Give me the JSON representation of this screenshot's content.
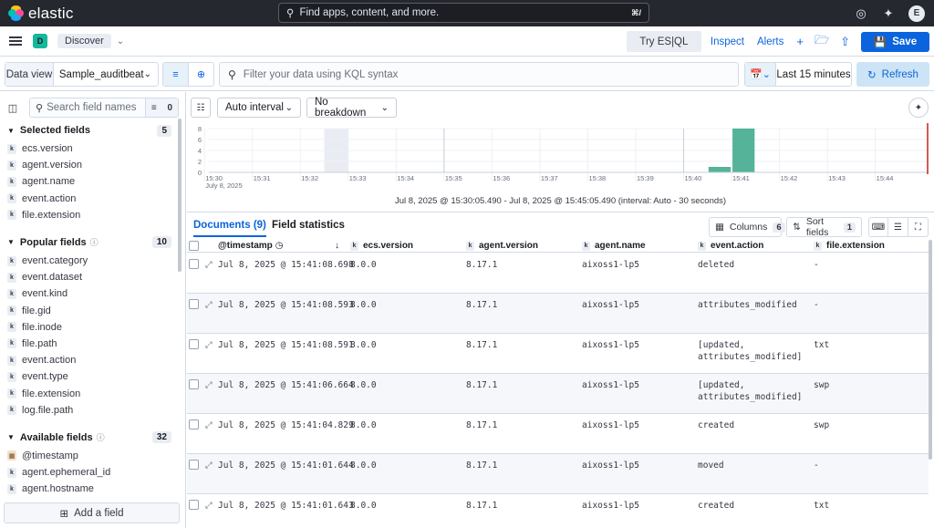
{
  "topbar": {
    "brand": "elastic",
    "search_placeholder": "Find apps, content, and more.",
    "search_shortcut": "⌘/",
    "avatar_initial": "E"
  },
  "appbar": {
    "space_initial": "D",
    "breadcrumb": "Discover",
    "try_esql": "Try ES|QL",
    "inspect": "Inspect",
    "alerts": "Alerts",
    "save": "Save"
  },
  "querybar": {
    "data_view_label": "Data view",
    "data_view_value": "Sample_auditbeat",
    "kql_placeholder": "Filter your data using KQL syntax",
    "time_range": "Last 15 minutes",
    "refresh": "Refresh"
  },
  "sidebar": {
    "search_placeholder": "Search field names",
    "filter_count": "0",
    "selected": {
      "title": "Selected fields",
      "count": "5",
      "fields": [
        "ecs.version",
        "agent.version",
        "agent.name",
        "event.action",
        "file.extension"
      ]
    },
    "popular": {
      "title": "Popular fields",
      "count": "10",
      "fields": [
        "event.category",
        "event.dataset",
        "event.kind",
        "file.gid",
        "file.inode",
        "file.path",
        "event.action",
        "event.type",
        "file.extension",
        "log.file.path"
      ]
    },
    "available": {
      "title": "Available fields",
      "count": "32",
      "fields": [
        {
          "name": "@timestamp",
          "type": "date"
        },
        {
          "name": "agent.ephemeral_id",
          "type": "k"
        },
        {
          "name": "agent.hostname",
          "type": "k"
        }
      ]
    },
    "add_field": "Add a field"
  },
  "toolbar": {
    "interval": "Auto interval",
    "breakdown": "No breakdown"
  },
  "chart_data": {
    "type": "bar",
    "y_ticks": [
      "8",
      "6",
      "4",
      "2",
      "0"
    ],
    "ylim": [
      0,
      8
    ],
    "x_ticks": [
      "15:30",
      "15:31",
      "15:32",
      "15:33",
      "15:34",
      "15:35",
      "15:36",
      "15:37",
      "15:38",
      "15:39",
      "15:40",
      "15:41",
      "15:42",
      "15:43",
      "15:44"
    ],
    "x_sublabel": "July 8, 2025",
    "bars": [
      {
        "x": "15:40:30",
        "value": 1
      },
      {
        "x": "15:41:00",
        "value": 8
      }
    ],
    "bar_color": "#54b399",
    "caption": "Jul 8, 2025 @ 15:30:05.490 - Jul 8, 2025 @ 15:45:05.490 (interval: Auto - 30 seconds)"
  },
  "tabs": {
    "documents": "Documents (9)",
    "field_statistics": "Field statistics",
    "columns": "Columns",
    "columns_count": "6",
    "sort_fields": "Sort fields",
    "sort_count": "1"
  },
  "grid": {
    "columns": [
      "@timestamp",
      "ecs.version",
      "agent.version",
      "agent.name",
      "event.action",
      "file.extension"
    ],
    "rows": [
      {
        "ts": "Jul 8, 2025 @ 15:41:08.698",
        "ecs": "8.0.0",
        "agent_version": "8.17.1",
        "agent_name": "aixoss1-lp5",
        "action1": "deleted",
        "action2": "",
        "ext": "-"
      },
      {
        "ts": "Jul 8, 2025 @ 15:41:08.593",
        "ecs": "8.0.0",
        "agent_version": "8.17.1",
        "agent_name": "aixoss1-lp5",
        "action1": "attributes_modified",
        "action2": "",
        "ext": "-"
      },
      {
        "ts": "Jul 8, 2025 @ 15:41:08.591",
        "ecs": "8.0.0",
        "agent_version": "8.17.1",
        "agent_name": "aixoss1-lp5",
        "action1": "[updated,",
        "action2": "attributes_modified]",
        "ext": "txt"
      },
      {
        "ts": "Jul 8, 2025 @ 15:41:06.664",
        "ecs": "8.0.0",
        "agent_version": "8.17.1",
        "agent_name": "aixoss1-lp5",
        "action1": "[updated,",
        "action2": "attributes_modified]",
        "ext": "swp"
      },
      {
        "ts": "Jul 8, 2025 @ 15:41:04.829",
        "ecs": "8.0.0",
        "agent_version": "8.17.1",
        "agent_name": "aixoss1-lp5",
        "action1": "created",
        "action2": "",
        "ext": "swp"
      },
      {
        "ts": "Jul 8, 2025 @ 15:41:01.644",
        "ecs": "8.0.0",
        "agent_version": "8.17.1",
        "agent_name": "aixoss1-lp5",
        "action1": "moved",
        "action2": "",
        "ext": "-"
      },
      {
        "ts": "Jul 8, 2025 @ 15:41:01.643",
        "ecs": "8.0.0",
        "agent_version": "8.17.1",
        "agent_name": "aixoss1-lp5",
        "action1": "created",
        "action2": "",
        "ext": "txt"
      }
    ]
  }
}
